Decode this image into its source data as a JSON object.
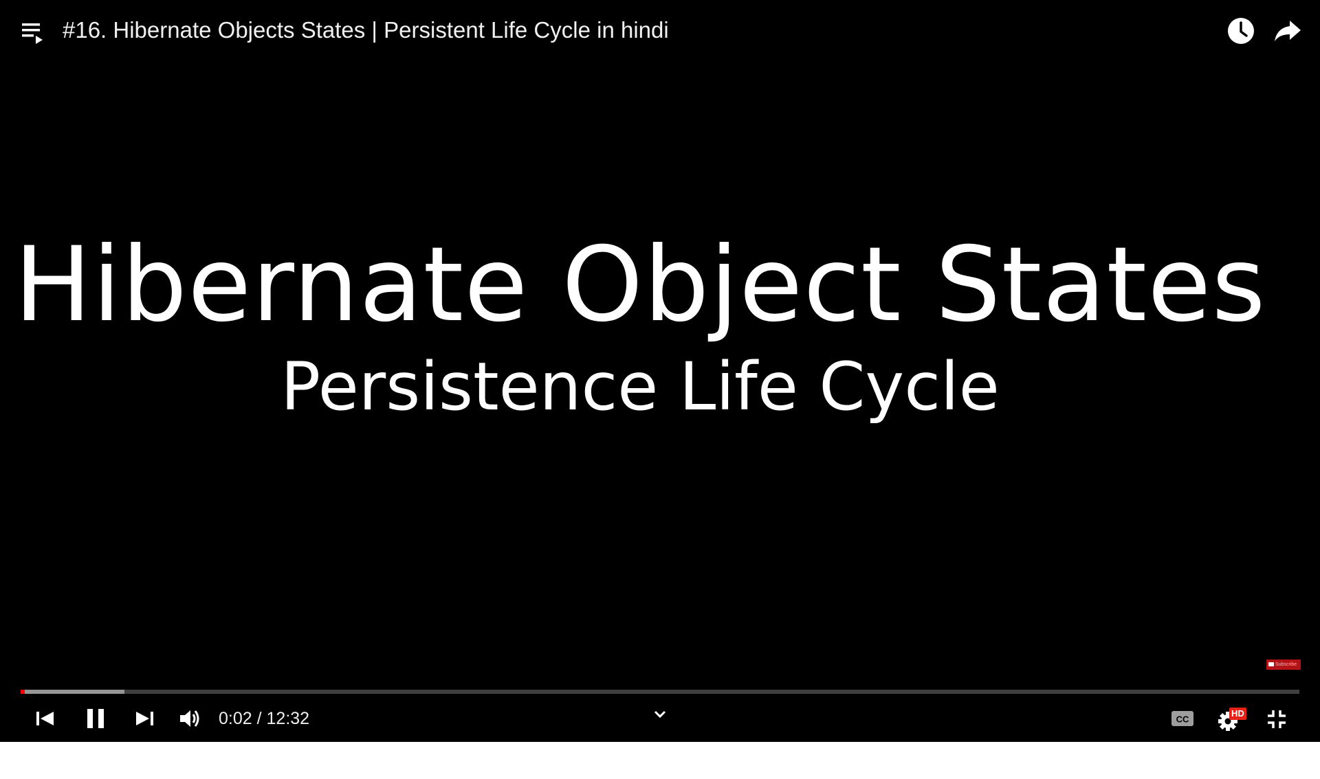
{
  "player": {
    "title": "#16. Hibernate Objects States | Persistent Life Cycle in hindi",
    "frame": {
      "heading": "Hibernate Object States",
      "subheading": "Persistence Life Cycle"
    },
    "watermark": {
      "label": "Subscribe",
      "color": "#b31217"
    },
    "progress": {
      "played_fraction": 0.0027,
      "buffered_fraction": 0.081,
      "played_color": "#ff0000"
    },
    "controls": {
      "current_time": "0:02",
      "separator": " / ",
      "duration": "12:32",
      "settings_badge": "HD"
    },
    "icons": {
      "top_left": "playlist-icon",
      "top_right": [
        "watch-later-icon",
        "share-icon"
      ],
      "bottom_left": [
        "previous-icon",
        "pause-icon",
        "next-icon",
        "volume-icon"
      ],
      "bottom_center": "chevron-down-icon",
      "bottom_right": [
        "closed-captions-icon",
        "settings-icon",
        "exit-fullscreen-icon"
      ]
    }
  }
}
